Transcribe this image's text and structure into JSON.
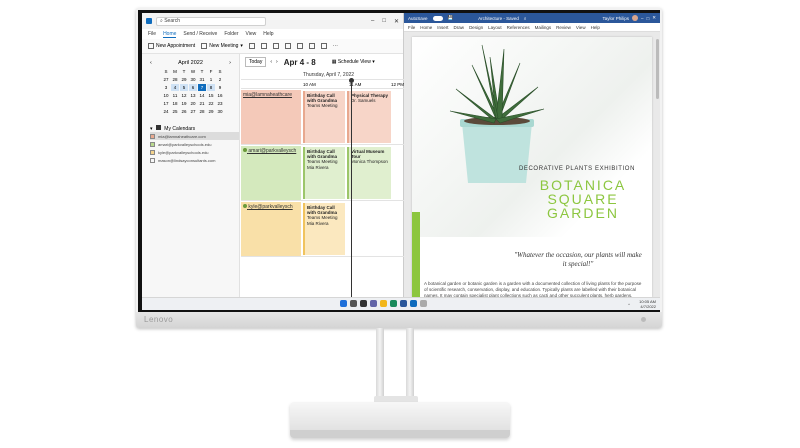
{
  "monitor": {
    "brand": "Lenovo"
  },
  "outlook": {
    "search": "Search",
    "window_controls": [
      "–",
      "□",
      "✕"
    ],
    "menu": [
      "File",
      "Home",
      "Send / Receive",
      "Folder",
      "View",
      "Help"
    ],
    "active_menu": "Home",
    "ribbon": {
      "new_appointment": "New Appointment",
      "new_meeting": "New Meeting",
      "more": "···"
    },
    "mini_calendar": {
      "month": "April 2022",
      "prev": "‹",
      "next": "›",
      "weekdays": [
        "S",
        "M",
        "T",
        "W",
        "T",
        "F",
        "S"
      ],
      "days": [
        "27",
        "28",
        "29",
        "30",
        "31",
        "1",
        "2",
        "3",
        "4",
        "5",
        "6",
        "7",
        "8",
        "9",
        "10",
        "11",
        "12",
        "13",
        "14",
        "15",
        "16",
        "17",
        "18",
        "19",
        "20",
        "21",
        "22",
        "23",
        "24",
        "25",
        "26",
        "27",
        "28",
        "29",
        "30"
      ]
    },
    "my_calendars_label": "My Calendars",
    "calendars": [
      "mia@lamnaheathcare.com",
      "amari@parkvalleyschools.edu",
      "kyle@parkvalleyschools.edu",
      "mason@lindsayconsultants.com"
    ],
    "nav": {
      "today": "Today",
      "prev": "‹",
      "next": "›",
      "range": "Apr 4 - 8",
      "schedule_view": "Schedule View"
    },
    "day_header": "Thursday, April 7, 2022",
    "time_labels": [
      "10 AM",
      "11 AM",
      "12 PM"
    ],
    "lanes": [
      {
        "person": "mia@lamnaheathcare",
        "event1_title": "Birthday Call with Grandma",
        "event1_sub": "Teams Meeting",
        "event2_title": "Physical Therapy",
        "event2_sub": "Dr. Samuels"
      },
      {
        "person": "amari@parkvalleysch",
        "event1_title": "Birthday Call with Grandma",
        "event1_sub": "Teams Meeting Mia Rivera",
        "event2_title": "Virtual Museum Tour",
        "event2_sub": "Monica Thompson"
      },
      {
        "person": "kyle@parkvalleysch",
        "event1_title": "Birthday Call with Grandma",
        "event1_sub": "Teams Meeting Mia Rivera",
        "event2_title": "",
        "event2_sub": ""
      }
    ]
  },
  "word": {
    "autosave": "AutoSave",
    "autosave_state": "On",
    "doc_title": "Architecture - Saved",
    "user": "Taylor Philips",
    "menu": [
      "File",
      "Home",
      "Insert",
      "Draw",
      "Design",
      "Layout",
      "References",
      "Mailings",
      "Review",
      "View",
      "Help"
    ],
    "headline": "DECORATIVE PLANTS EXHIBITION",
    "title": "BOTANICA SQUARE GARDEN",
    "quote": "\"Whatever the occasion, our plants will make it special!\"",
    "paragraph": "A botanical garden or botanic garden is a garden with a documented collection of living plants for the purpose of scientific research, conservation, display, and education. Typically plants are labelled with their botanical names. It may contain specialist plant collections such as cacti and other succulent plants, herb gardens, plants from particular parts of the"
  },
  "taskbar": {
    "tray": "^",
    "time": "10:05 AM",
    "date": "4/7/2022"
  },
  "colors": {
    "outlook_accent": "#0f6cbd",
    "word_blue": "#2b579a",
    "garden_green": "#8cc63f"
  }
}
